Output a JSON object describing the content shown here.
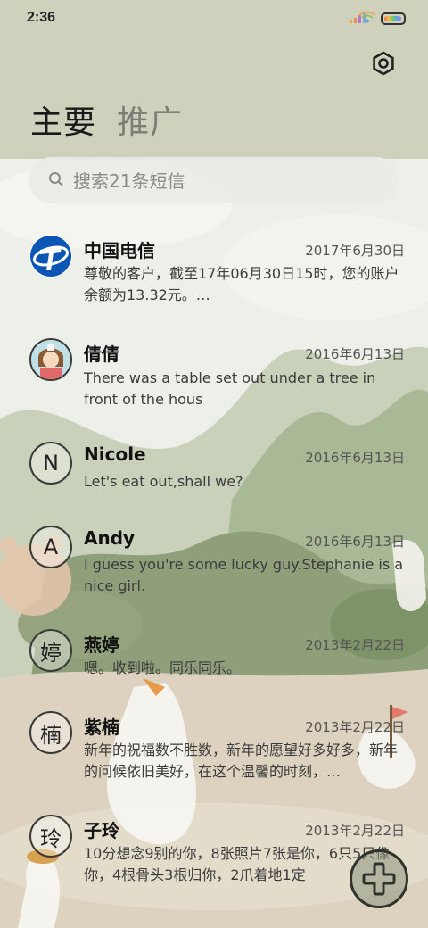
{
  "status_bar": {
    "time": "2:36"
  },
  "tabs": {
    "primary": "主要",
    "promotions": "推广"
  },
  "search": {
    "placeholder": "搜索21条短信"
  },
  "conversations": [
    {
      "name": "中国电信",
      "date": "2017年6月30日",
      "preview": "尊敬的客户，截至17年06月30日15时，您的账户余额为13.32元。…",
      "avatar_type": "china-telecom-logo",
      "avatar_letter": ""
    },
    {
      "name": "倩倩",
      "date": "2016年6月13日",
      "preview": "There was a table set out under a tree in front of the hous",
      "avatar_type": "photo",
      "avatar_letter": ""
    },
    {
      "name": "Nicole",
      "date": "2016年6月13日",
      "preview": "Let's eat out,shall we?",
      "avatar_type": "letter",
      "avatar_letter": "N"
    },
    {
      "name": "Andy",
      "date": "2016年6月13日",
      "preview": "I guess you're some lucky guy.Stephanie is a nice girl.",
      "avatar_type": "letter",
      "avatar_letter": "A"
    },
    {
      "name": "燕婷",
      "date": "2013年2月22日",
      "preview": "嗯。收到啦。同乐同乐。",
      "avatar_type": "letter",
      "avatar_letter": "婷"
    },
    {
      "name": "紫楠",
      "date": "2013年2月22日",
      "preview": "新年的祝福数不胜数，新年的愿望好多好多，新年的问候依旧美好，在这个温馨的时刻，…",
      "avatar_type": "letter",
      "avatar_letter": "楠"
    },
    {
      "name": "子玲",
      "date": "2013年2月22日",
      "preview": "10分想念9别的你，8张照片7张是你，6只5只像你，4根骨头3根归你，2爪着地1定",
      "avatar_type": "letter",
      "avatar_letter": "玲"
    }
  ],
  "icons": {
    "settings": "settings-icon",
    "search": "search-icon",
    "compose": "compose-plus-icon"
  },
  "colors": {
    "header": "#cfd1bc",
    "telecom_blue": "#0b55b5"
  }
}
